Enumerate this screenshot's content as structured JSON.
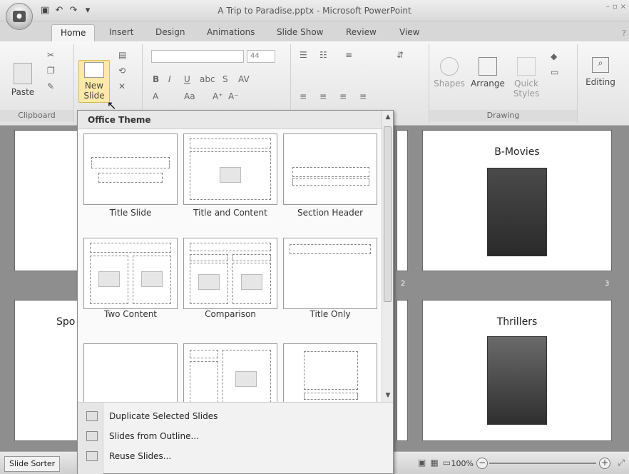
{
  "window": {
    "title": "A Trip to Paradise.pptx - Microsoft PowerPoint"
  },
  "tabs": [
    "Home",
    "Insert",
    "Design",
    "Animations",
    "Slide Show",
    "Review",
    "View"
  ],
  "ribbon": {
    "clipboard": {
      "paste": "Paste",
      "label": "Clipboard"
    },
    "slides": {
      "new_slide": "New",
      "new_slide_2": "Slide"
    },
    "font_size": "44",
    "drawing": {
      "shapes": "Shapes",
      "arrange": "Arrange",
      "quick_styles": "Quick",
      "quick_styles_2": "Styles",
      "label": "Drawing"
    },
    "editing": "Editing"
  },
  "dropdown": {
    "header": "Office Theme",
    "layouts": [
      "Title Slide",
      "Title and Content",
      "Section Header",
      "Two Content",
      "Comparison",
      "Title Only"
    ],
    "menu": [
      "Duplicate Selected Slides",
      "Slides from Outline...",
      "Reuse Slides..."
    ]
  },
  "slides": [
    {
      "title": "B-Movies",
      "num": ""
    },
    {
      "title": "Thrillers",
      "num": ""
    },
    {
      "title": "Spo",
      "num": ""
    }
  ],
  "slide_numbers": [
    "2",
    "3"
  ],
  "status": {
    "view": "Slide Sorter",
    "zoom": "100%"
  }
}
